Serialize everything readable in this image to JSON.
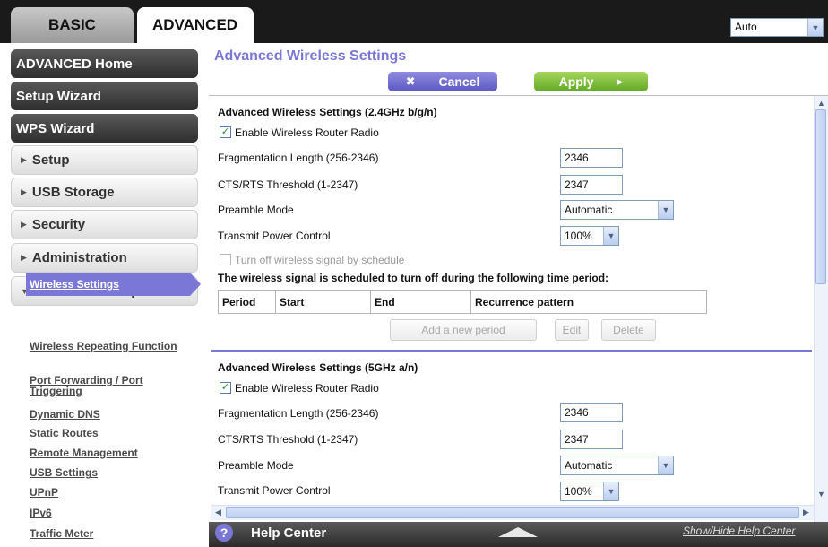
{
  "top_tabs": {
    "basic": "BASIC",
    "advanced": "ADVANCED"
  },
  "language_select": {
    "value": "Auto"
  },
  "sidebar": {
    "advanced_home": "ADVANCED Home",
    "setup_wizard": "Setup Wizard",
    "wps_wizard": "WPS Wizard",
    "setup": "Setup",
    "usb_storage": "USB Storage",
    "security": "Security",
    "administration": "Administration",
    "advanced_setup": "Advanced Setup",
    "submenu": [
      "Wireless Settings",
      "Wireless Repeating Function",
      "Port Forwarding / Port Triggering",
      "Dynamic DNS",
      "Static Routes",
      "Remote Management",
      "USB Settings",
      "UPnP",
      "IPv6",
      "Traffic Meter"
    ]
  },
  "page_title": "Advanced Wireless Settings",
  "buttons": {
    "cancel": "Cancel",
    "apply": "Apply"
  },
  "section_24": {
    "title": "Advanced Wireless Settings (2.4GHz b/g/n)",
    "enable_radio": "Enable Wireless Router Radio",
    "frag_label": "Fragmentation Length (256-2346)",
    "frag_value": "2346",
    "cts_label": "CTS/RTS Threshold (1-2347)",
    "cts_value": "2347",
    "preamble_label": "Preamble Mode",
    "preamble_value": "Automatic",
    "power_label": "Transmit Power Control",
    "power_value": "100%",
    "schedule_check": "Turn off wireless signal by schedule",
    "schedule_note": "The wireless signal is scheduled to turn off during the following time period:",
    "table_headers": [
      "Period",
      "Start",
      "End",
      "Recurrence pattern"
    ],
    "add_period": "Add a new period",
    "edit": "Edit",
    "delete": "Delete"
  },
  "section_5": {
    "title": "Advanced Wireless Settings (5GHz a/n)",
    "enable_radio": "Enable Wireless Router Radio",
    "frag_label": "Fragmentation Length (256-2346)",
    "frag_value": "2346",
    "cts_label": "CTS/RTS Threshold (1-2347)",
    "cts_value": "2347",
    "preamble_label": "Preamble Mode",
    "preamble_value": "Automatic",
    "power_label": "Transmit Power Control",
    "power_value": "100%"
  },
  "help": {
    "label": "Help Center",
    "toggle": "Show/Hide Help Center"
  },
  "colors": {
    "accent": "#7b77d6",
    "apply_green": "#62a925",
    "dark_bar": "#1a1a1a"
  }
}
